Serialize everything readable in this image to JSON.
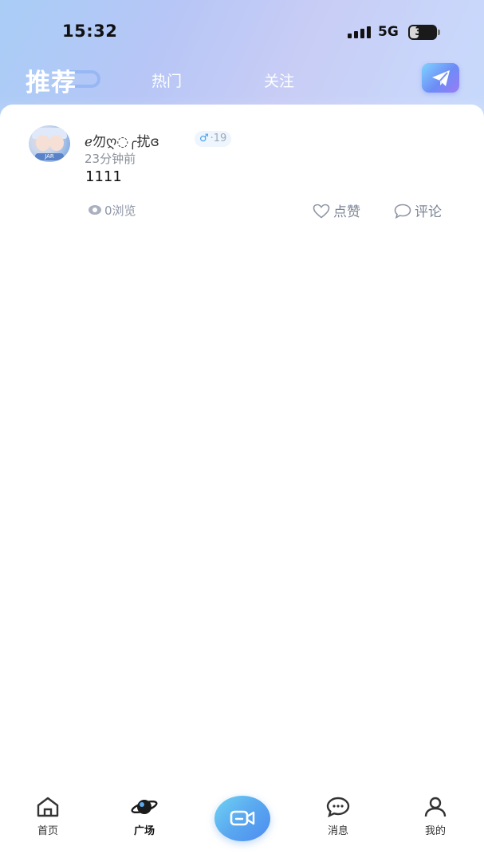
{
  "status_bar": {
    "time": "15:32",
    "network": "5G",
    "battery": "34",
    "battery_level": 0.34
  },
  "tabs": [
    {
      "label": "推荐",
      "active": true
    },
    {
      "label": "热门",
      "active": false
    },
    {
      "label": "关注",
      "active": false
    }
  ],
  "send_icon": "paper-plane-icon",
  "post": {
    "username": "ℯ勿ღ◌╭扰ɞ",
    "gender_symbol": "♂",
    "age": "·19",
    "time_ago": "23分钟前",
    "content": "1111",
    "views": "0浏览",
    "like_label": "点赞",
    "comment_label": "评论",
    "avatar_caption": "JAR"
  },
  "bottom_nav": {
    "home": "首页",
    "square": "广场",
    "messages": "消息",
    "mine": "我的",
    "center_icon": "video-camera-icon"
  },
  "colors": {
    "accent": "#5aa8f0",
    "gender_male": "#3e9ff2",
    "muted_text": "#8a8f99"
  }
}
